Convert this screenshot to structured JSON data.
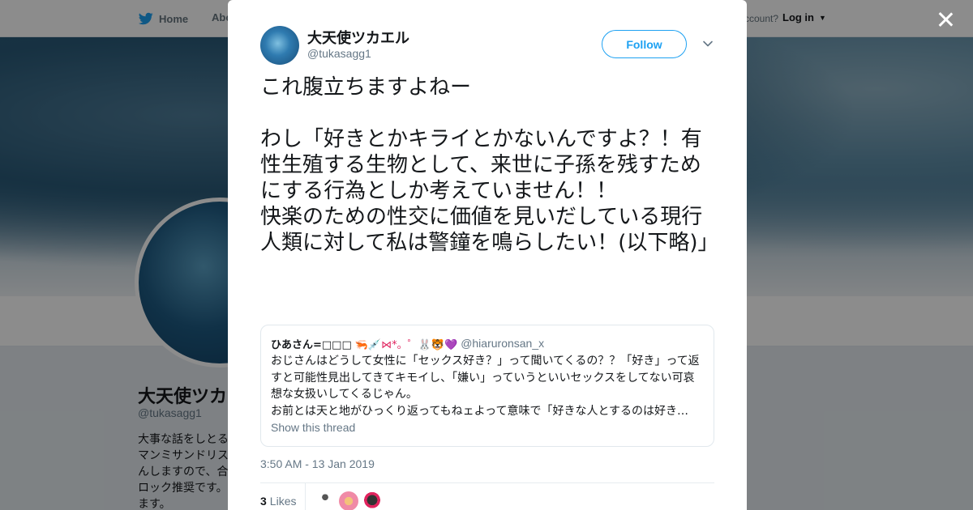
{
  "nav": {
    "home_label": "Home",
    "about_label": "Abo",
    "account_prompt": "ccount?",
    "login_label": "Log in"
  },
  "profile": {
    "name": "大天使ツカエ",
    "handle": "@tukasagg1",
    "bio": "大事な話をしとるマンミサンドリスんしますので、合ロック推奨です。ます。"
  },
  "tweet": {
    "author_name": "大天使ツカエル",
    "author_handle": "@tukasagg1",
    "follow_label": "Follow",
    "text": "これ腹立ちますよねー\n\nわし「好きとかキライとかないんですよ？！有性生殖する生物として、来世に子孫を残すためにする行為としか考えていません！！\n快楽のための性交に価値を見いだしている現行人類に対して私は警鐘を鳴らしたい！(以下略)」",
    "timestamp": "3:50 AM - 13 Jan 2019",
    "likes_count": "3",
    "likes_label": "Likes"
  },
  "quote": {
    "name": "ひあさん=□□□",
    "emojis": "🦐💉⋈*。゜🐰🐯💜",
    "handle": "@hiaruronsan_x",
    "body": "おじさんはどうして女性に「セックス好き？」って聞いてくるの？？「好き」って返すと可能性見出してきてキモイし、「嫌い」っていうといいセックスをしてない可哀想な女扱いしてくるじゃん。\nお前とは天と地がひっくり返ってもねェよって意味で「好きな人とするのは好き…",
    "show_thread_label": "Show this thread"
  },
  "colors": {
    "accent": "#1da1f2",
    "secondary_text": "#657786",
    "primary_text": "#14171a",
    "border": "#e1e8ed"
  },
  "icons": {
    "brand": "twitter-bird-icon",
    "close": "close-icon",
    "caret": "chevron-down-icon"
  }
}
